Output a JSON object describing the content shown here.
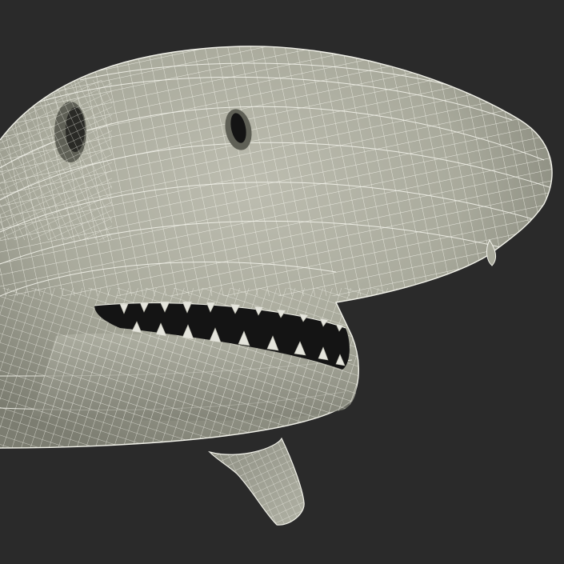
{
  "scene": {
    "subject": "shark-head-wireframe",
    "colors": {
      "background": "#2a2a2a",
      "skin": "#a9aa9c",
      "skin_light": "#bdbdb0",
      "skin_shadow": "#6e6f63",
      "wire": "#f2f2ea",
      "mouth": "#141414",
      "tooth": "#e4e4dc"
    }
  }
}
